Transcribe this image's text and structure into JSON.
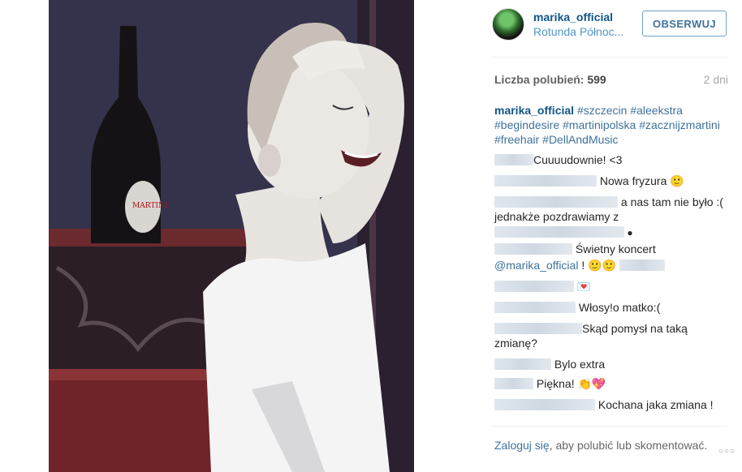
{
  "header": {
    "username": "marika_official",
    "location": "Rotunda Północ...",
    "follow_label": "OBSERWUJ"
  },
  "likes": {
    "label": "Liczba polubień:",
    "count": "599",
    "time": "2 dni"
  },
  "caption": {
    "user": "marika_official",
    "tags": [
      "#szczecin",
      "#aleekstra",
      "#begindesire",
      "#martinipolska",
      "#zacznijzmartini",
      "#freehair",
      "#DellAndMusic"
    ]
  },
  "comments": [
    {
      "text": "Cuuuudownie! <3"
    },
    {
      "text": "Nowa fryzura 🙂"
    },
    {
      "text": "a nas tam nie było :( jednakże pozdrawiamy z"
    },
    {
      "text": "Świetny koncert"
    },
    {
      "mention": "@marika_official",
      "text": "! 🙂🙂"
    },
    {
      "text": "💌"
    },
    {
      "text": "Włosy!o matko:("
    },
    {
      "text": "Skąd pomysł na taką zmianę?"
    },
    {
      "text": "Bylo extra"
    },
    {
      "text": "Piękna! 👏💖"
    },
    {
      "text": "Kochana jaka zmiana !"
    }
  ],
  "footer": {
    "login_link": "Zaloguj się",
    "rest": ", aby polubić lub skomentować."
  },
  "icons": {
    "more": "more-options-icon"
  }
}
